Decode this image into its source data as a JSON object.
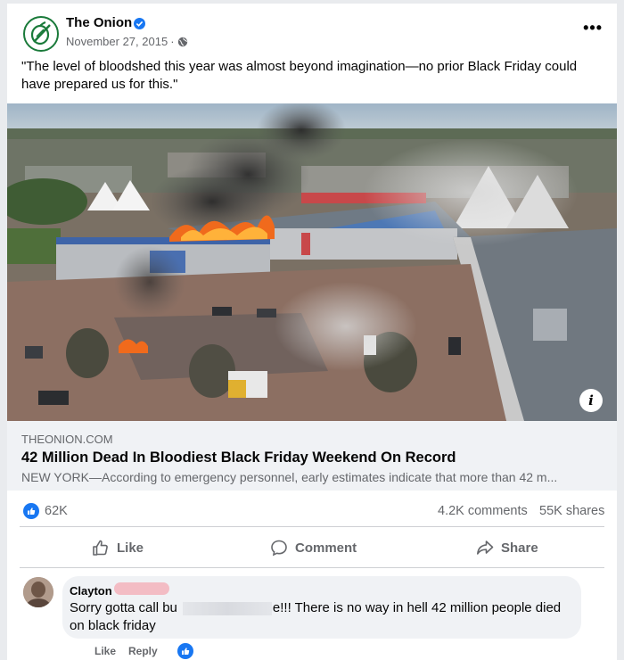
{
  "post": {
    "page_name": "The Onion",
    "date": "November 27, 2015",
    "separator": "·",
    "privacy_icon": "globe-icon",
    "more_icon": "more-options-icon",
    "caption": "\"The level of bloodshed this year was almost beyond imagination—no prior Black Friday could have prepared us for this.\""
  },
  "link": {
    "domain": "THEONION.COM",
    "title": "42 Million Dead In Bloodiest Black Friday Weekend On Record",
    "description": "NEW YORK—According to emergency personnel, early estimates indicate that more than 42 m...",
    "info_label": "i"
  },
  "stats": {
    "likes": "62K",
    "comments": "4.2K comments",
    "shares": "55K shares"
  },
  "actions": {
    "like": "Like",
    "comment": "Comment",
    "share": "Share"
  },
  "comment": {
    "author": "Clayton",
    "text_before": "Sorry gotta call bu",
    "text_after": "e!!! There is no way in hell 42 million people died on black friday",
    "like_label": "Like",
    "reply_label": "Reply"
  },
  "colors": {
    "brand_blue": "#1877f2",
    "onion_green": "#1a7a3a",
    "muted_text": "#65676b"
  }
}
